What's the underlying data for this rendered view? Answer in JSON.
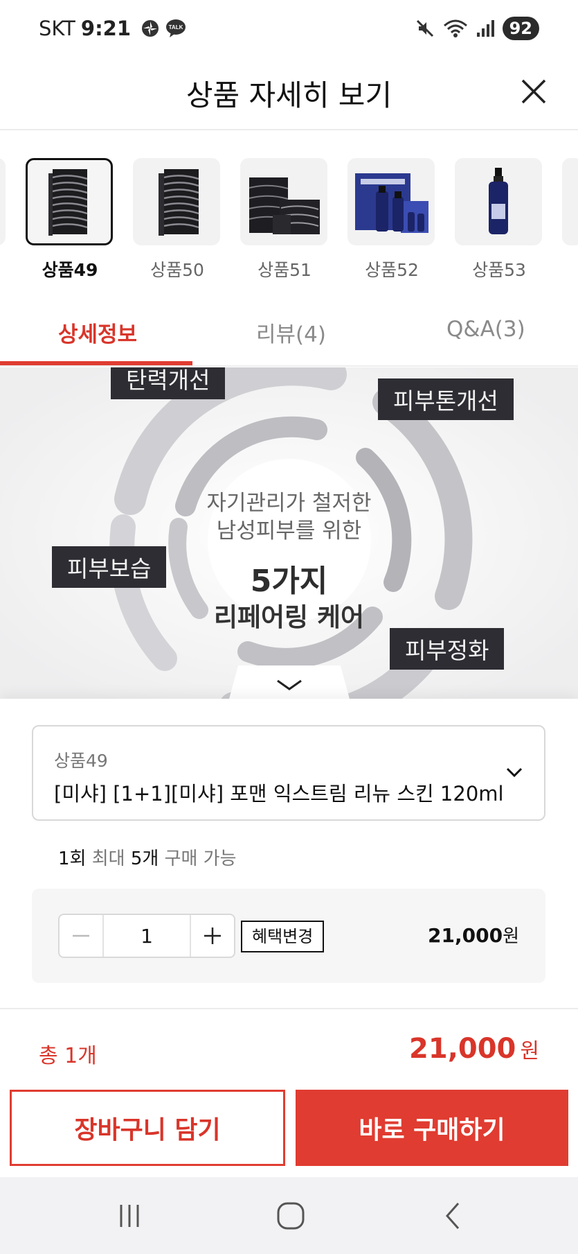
{
  "status_bar": {
    "carrier": "SKT",
    "time": "9:21",
    "battery": "92",
    "icons": [
      "pinwheel-icon",
      "kakaotalk-icon",
      "mute-icon",
      "wifi-icon",
      "signal-icon"
    ],
    "talk_badge": "TALK"
  },
  "header": {
    "title": "상품 자세히 보기",
    "close_icon": "close-icon"
  },
  "carousel": {
    "items": [
      {
        "label": "상품49",
        "selected": true,
        "image": "black-striped-box"
      },
      {
        "label": "상품50",
        "selected": false,
        "image": "black-striped-box"
      },
      {
        "label": "상품51",
        "selected": false,
        "image": "black-gift-set"
      },
      {
        "label": "상품52",
        "selected": false,
        "image": "navy-bottle-set"
      },
      {
        "label": "상품53",
        "selected": false,
        "image": "navy-spray-bottle"
      }
    ]
  },
  "tabs": [
    {
      "label": "상세정보",
      "active": true
    },
    {
      "label": "리뷰(4)",
      "active": false
    },
    {
      "label": "Q&A(3)",
      "active": false
    }
  ],
  "detail_image": {
    "labels": [
      "탄력개선",
      "피부톤개선",
      "피부보습",
      "피부정화"
    ],
    "subtitle_line1": "자기관리가 철저한",
    "subtitle_line2": "남성피부를 위한",
    "headline": "5가지",
    "headline_sub": "리페어링 케어"
  },
  "option": {
    "small_label": "상품49",
    "name": "[미샤] [1+1][미샤] 포맨 익스트림 리뉴 스킨 120ml",
    "chevron_icon": "chevron-down-icon"
  },
  "limit_note": {
    "qty_once": "1회",
    "max_label": "최대",
    "max_qty": "5개",
    "suffix": "구매 가능"
  },
  "quantity": {
    "value": "1",
    "minus": "minus-icon",
    "plus": "plus-icon",
    "benefit_label": "혜택변경",
    "price": "21,000",
    "unit": "원"
  },
  "total": {
    "count_label": "총 1개",
    "price": "21,000",
    "unit": "원"
  },
  "actions": {
    "cart_label": "장바구니 담기",
    "buy_label": "바로 구매하기"
  },
  "colors": {
    "accent": "#e03c31",
    "accent_text": "#d9352a",
    "label_bg": "#2d2d33"
  },
  "nav": {
    "recent": "recent-apps-icon",
    "home": "home-icon",
    "back": "back-icon"
  }
}
